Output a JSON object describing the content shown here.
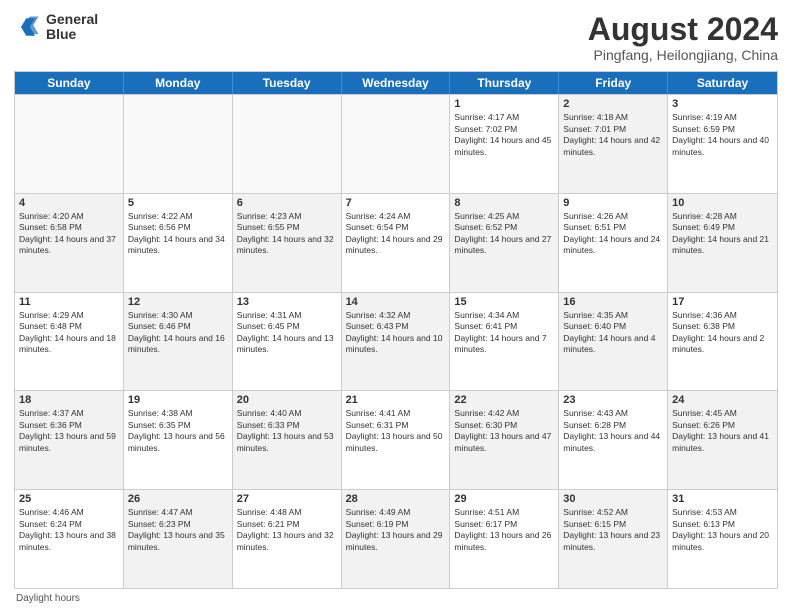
{
  "logo": {
    "line1": "General",
    "line2": "Blue"
  },
  "title": "August 2024",
  "subtitle": "Pingfang, Heilongjiang, China",
  "days_of_week": [
    "Sunday",
    "Monday",
    "Tuesday",
    "Wednesday",
    "Thursday",
    "Friday",
    "Saturday"
  ],
  "footer": "Daylight hours",
  "weeks": [
    [
      {
        "day": "",
        "info": "",
        "shaded": false,
        "empty": true
      },
      {
        "day": "",
        "info": "",
        "shaded": false,
        "empty": true
      },
      {
        "day": "",
        "info": "",
        "shaded": false,
        "empty": true
      },
      {
        "day": "",
        "info": "",
        "shaded": false,
        "empty": true
      },
      {
        "day": "1",
        "info": "Sunrise: 4:17 AM\nSunset: 7:02 PM\nDaylight: 14 hours and 45 minutes.",
        "shaded": false,
        "empty": false
      },
      {
        "day": "2",
        "info": "Sunrise: 4:18 AM\nSunset: 7:01 PM\nDaylight: 14 hours and 42 minutes.",
        "shaded": true,
        "empty": false
      },
      {
        "day": "3",
        "info": "Sunrise: 4:19 AM\nSunset: 6:59 PM\nDaylight: 14 hours and 40 minutes.",
        "shaded": false,
        "empty": false
      }
    ],
    [
      {
        "day": "4",
        "info": "Sunrise: 4:20 AM\nSunset: 6:58 PM\nDaylight: 14 hours and 37 minutes.",
        "shaded": true,
        "empty": false
      },
      {
        "day": "5",
        "info": "Sunrise: 4:22 AM\nSunset: 6:56 PM\nDaylight: 14 hours and 34 minutes.",
        "shaded": false,
        "empty": false
      },
      {
        "day": "6",
        "info": "Sunrise: 4:23 AM\nSunset: 6:55 PM\nDaylight: 14 hours and 32 minutes.",
        "shaded": true,
        "empty": false
      },
      {
        "day": "7",
        "info": "Sunrise: 4:24 AM\nSunset: 6:54 PM\nDaylight: 14 hours and 29 minutes.",
        "shaded": false,
        "empty": false
      },
      {
        "day": "8",
        "info": "Sunrise: 4:25 AM\nSunset: 6:52 PM\nDaylight: 14 hours and 27 minutes.",
        "shaded": true,
        "empty": false
      },
      {
        "day": "9",
        "info": "Sunrise: 4:26 AM\nSunset: 6:51 PM\nDaylight: 14 hours and 24 minutes.",
        "shaded": false,
        "empty": false
      },
      {
        "day": "10",
        "info": "Sunrise: 4:28 AM\nSunset: 6:49 PM\nDaylight: 14 hours and 21 minutes.",
        "shaded": true,
        "empty": false
      }
    ],
    [
      {
        "day": "11",
        "info": "Sunrise: 4:29 AM\nSunset: 6:48 PM\nDaylight: 14 hours and 18 minutes.",
        "shaded": false,
        "empty": false
      },
      {
        "day": "12",
        "info": "Sunrise: 4:30 AM\nSunset: 6:46 PM\nDaylight: 14 hours and 16 minutes.",
        "shaded": true,
        "empty": false
      },
      {
        "day": "13",
        "info": "Sunrise: 4:31 AM\nSunset: 6:45 PM\nDaylight: 14 hours and 13 minutes.",
        "shaded": false,
        "empty": false
      },
      {
        "day": "14",
        "info": "Sunrise: 4:32 AM\nSunset: 6:43 PM\nDaylight: 14 hours and 10 minutes.",
        "shaded": true,
        "empty": false
      },
      {
        "day": "15",
        "info": "Sunrise: 4:34 AM\nSunset: 6:41 PM\nDaylight: 14 hours and 7 minutes.",
        "shaded": false,
        "empty": false
      },
      {
        "day": "16",
        "info": "Sunrise: 4:35 AM\nSunset: 6:40 PM\nDaylight: 14 hours and 4 minutes.",
        "shaded": true,
        "empty": false
      },
      {
        "day": "17",
        "info": "Sunrise: 4:36 AM\nSunset: 6:38 PM\nDaylight: 14 hours and 2 minutes.",
        "shaded": false,
        "empty": false
      }
    ],
    [
      {
        "day": "18",
        "info": "Sunrise: 4:37 AM\nSunset: 6:36 PM\nDaylight: 13 hours and 59 minutes.",
        "shaded": true,
        "empty": false
      },
      {
        "day": "19",
        "info": "Sunrise: 4:38 AM\nSunset: 6:35 PM\nDaylight: 13 hours and 56 minutes.",
        "shaded": false,
        "empty": false
      },
      {
        "day": "20",
        "info": "Sunrise: 4:40 AM\nSunset: 6:33 PM\nDaylight: 13 hours and 53 minutes.",
        "shaded": true,
        "empty": false
      },
      {
        "day": "21",
        "info": "Sunrise: 4:41 AM\nSunset: 6:31 PM\nDaylight: 13 hours and 50 minutes.",
        "shaded": false,
        "empty": false
      },
      {
        "day": "22",
        "info": "Sunrise: 4:42 AM\nSunset: 6:30 PM\nDaylight: 13 hours and 47 minutes.",
        "shaded": true,
        "empty": false
      },
      {
        "day": "23",
        "info": "Sunrise: 4:43 AM\nSunset: 6:28 PM\nDaylight: 13 hours and 44 minutes.",
        "shaded": false,
        "empty": false
      },
      {
        "day": "24",
        "info": "Sunrise: 4:45 AM\nSunset: 6:26 PM\nDaylight: 13 hours and 41 minutes.",
        "shaded": true,
        "empty": false
      }
    ],
    [
      {
        "day": "25",
        "info": "Sunrise: 4:46 AM\nSunset: 6:24 PM\nDaylight: 13 hours and 38 minutes.",
        "shaded": false,
        "empty": false
      },
      {
        "day": "26",
        "info": "Sunrise: 4:47 AM\nSunset: 6:23 PM\nDaylight: 13 hours and 35 minutes.",
        "shaded": true,
        "empty": false
      },
      {
        "day": "27",
        "info": "Sunrise: 4:48 AM\nSunset: 6:21 PM\nDaylight: 13 hours and 32 minutes.",
        "shaded": false,
        "empty": false
      },
      {
        "day": "28",
        "info": "Sunrise: 4:49 AM\nSunset: 6:19 PM\nDaylight: 13 hours and 29 minutes.",
        "shaded": true,
        "empty": false
      },
      {
        "day": "29",
        "info": "Sunrise: 4:51 AM\nSunset: 6:17 PM\nDaylight: 13 hours and 26 minutes.",
        "shaded": false,
        "empty": false
      },
      {
        "day": "30",
        "info": "Sunrise: 4:52 AM\nSunset: 6:15 PM\nDaylight: 13 hours and 23 minutes.",
        "shaded": true,
        "empty": false
      },
      {
        "day": "31",
        "info": "Sunrise: 4:53 AM\nSunset: 6:13 PM\nDaylight: 13 hours and 20 minutes.",
        "shaded": false,
        "empty": false
      }
    ]
  ]
}
